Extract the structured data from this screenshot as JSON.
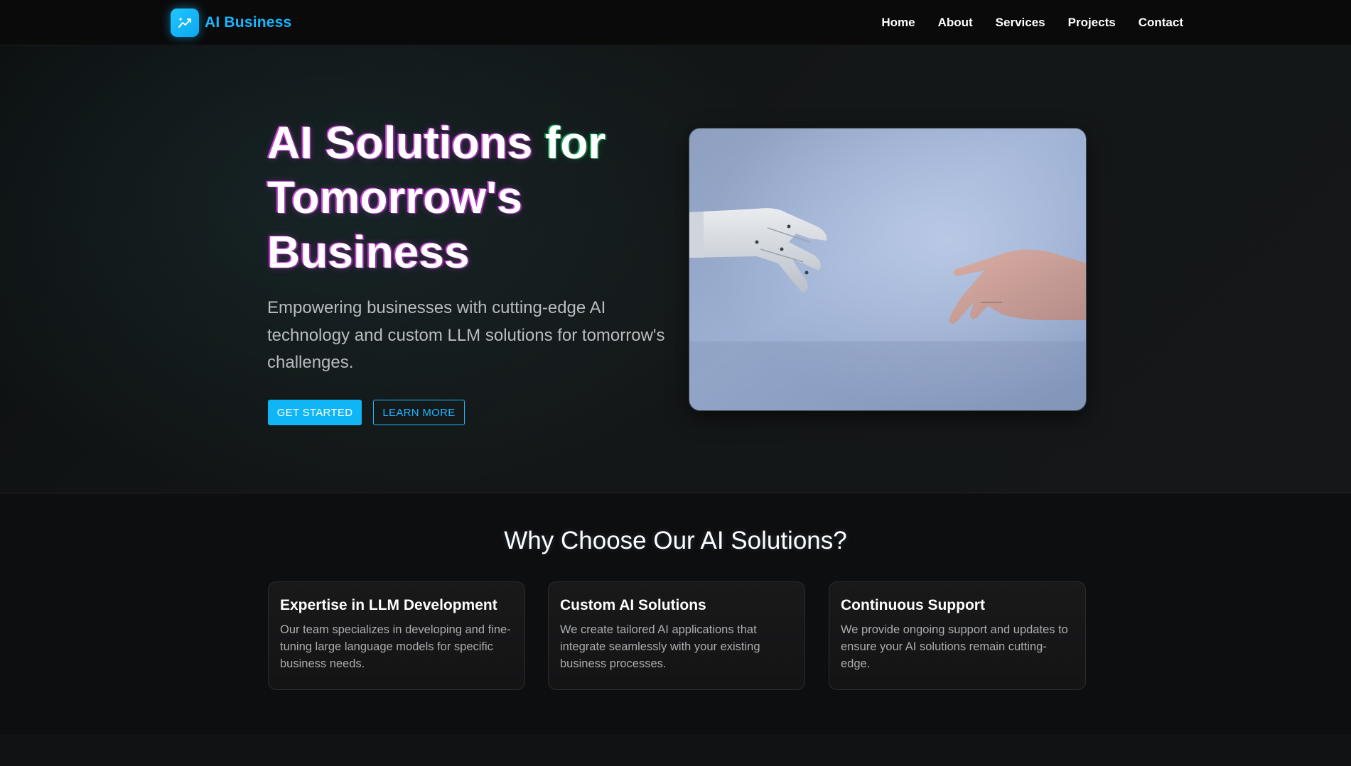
{
  "brand": {
    "name": "AI Business",
    "logo_icon": "sparkle-chart-icon",
    "accent_color": "#1ab7ff"
  },
  "nav": {
    "items": [
      {
        "label": "Home"
      },
      {
        "label": "About"
      },
      {
        "label": "Services"
      },
      {
        "label": "Projects"
      },
      {
        "label": "Contact"
      }
    ]
  },
  "hero": {
    "title_line1_a": "AI Solutions ",
    "title_line1_b": "for",
    "title_line2": "Tomorrow's",
    "title_line3": "Business",
    "subtitle": "Empowering businesses with cutting-edge AI technology and custom LLM solutions for tomorrow's challenges.",
    "primary_button": "GET STARTED",
    "secondary_button": "LEARN MORE",
    "image_subject": "robot-hand-reaching-human-hand-image"
  },
  "features": {
    "title": "Why Choose Our AI Solutions?",
    "cards": [
      {
        "title": "Expertise in LLM Development",
        "text": "Our team specializes in developing and fine-tuning large language models for specific business needs."
      },
      {
        "title": "Custom AI Solutions",
        "text": "We create tailored AI applications that integrate seamlessly with your existing business processes."
      },
      {
        "title": "Continuous Support",
        "text": "We provide ongoing support and updates to ensure your AI solutions remain cutting-edge."
      }
    ]
  }
}
